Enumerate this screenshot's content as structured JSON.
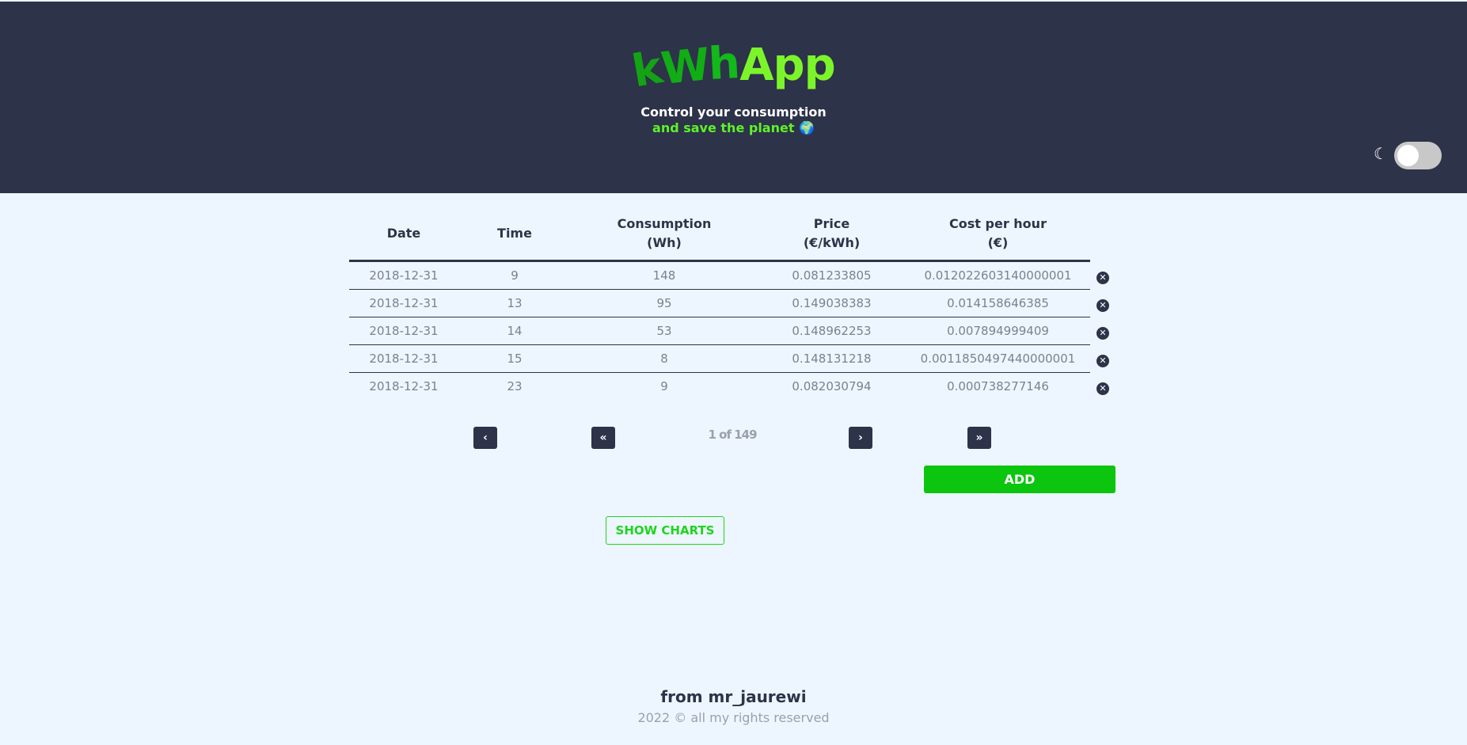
{
  "header": {
    "logo_part1": "k",
    "logo_part2": "W",
    "logo_part3": "h",
    "logo_part4": "App",
    "tagline_line1": "Control your consumption",
    "tagline_line2": "and save the planet 🌍",
    "theme_toggle_icon": "moon-icon",
    "theme_toggle_state": "off"
  },
  "table": {
    "columns": [
      {
        "line1": "Date",
        "line2": ""
      },
      {
        "line1": "Time",
        "line2": ""
      },
      {
        "line1": "Consumption",
        "line2": "(Wh)"
      },
      {
        "line1": "Price",
        "line2": "(€/kWh)"
      },
      {
        "line1": "Cost per hour",
        "line2": "(€)"
      }
    ],
    "rows": [
      {
        "date": "2018-12-31",
        "time": "9",
        "consumption": "148",
        "price": "0.081233805",
        "cost": "0.012022603140000001"
      },
      {
        "date": "2018-12-31",
        "time": "13",
        "consumption": "95",
        "price": "0.149038383",
        "cost": "0.014158646385"
      },
      {
        "date": "2018-12-31",
        "time": "14",
        "consumption": "53",
        "price": "0.148962253",
        "cost": "0.007894999409"
      },
      {
        "date": "2018-12-31",
        "time": "15",
        "consumption": "8",
        "price": "0.148131218",
        "cost": "0.0011850497440000001"
      },
      {
        "date": "2018-12-31",
        "time": "23",
        "consumption": "9",
        "price": "0.082030794",
        "cost": "0.000738277146"
      }
    ],
    "delete_icon": "close-circle-icon"
  },
  "pagination": {
    "first_label": "«",
    "prev_label": "‹",
    "info": "1 of 149",
    "next_label": "›",
    "last_label": "»"
  },
  "actions": {
    "add_label": "ADD",
    "show_charts_label": "SHOW CHARTS"
  },
  "footer": {
    "author": "from mr_jaurewi",
    "copyright": "2022 © all my rights reserved"
  }
}
